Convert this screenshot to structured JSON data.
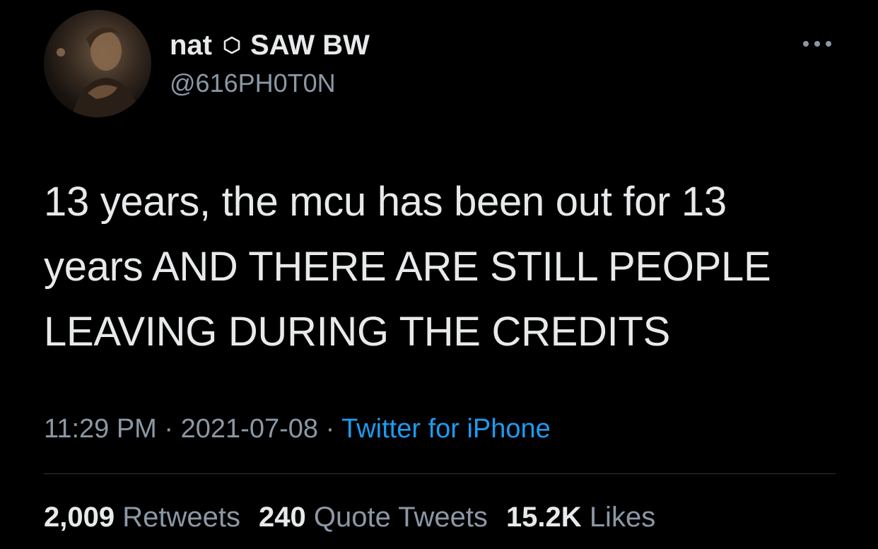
{
  "author": {
    "display_name": "nat",
    "display_name_suffix": "SAW BW",
    "handle": "@616PH0T0N",
    "avatar_icon": "avatar-photo-icon",
    "separator_icon": "hexagon-outline-icon"
  },
  "tweet": {
    "text": "13 years, the mcu has been out for 13 years AND THERE ARE STILL PEOPLE LEAVING DURING THE CREDITS"
  },
  "meta": {
    "time": "11:29 PM",
    "separator1": " · ",
    "date": "2021-07-08",
    "separator2": " · ",
    "source": "Twitter for iPhone"
  },
  "stats": {
    "retweets_count": "2,009",
    "retweets_label": "Retweets",
    "quotes_count": "240",
    "quotes_label": "Quote Tweets",
    "likes_count": "15.2K",
    "likes_label": "Likes"
  },
  "colors": {
    "background": "#000000",
    "text_primary": "#e7e9ea",
    "text_secondary": "#8b98a5",
    "link": "#1d9bf0",
    "divider": "#2f3336"
  }
}
